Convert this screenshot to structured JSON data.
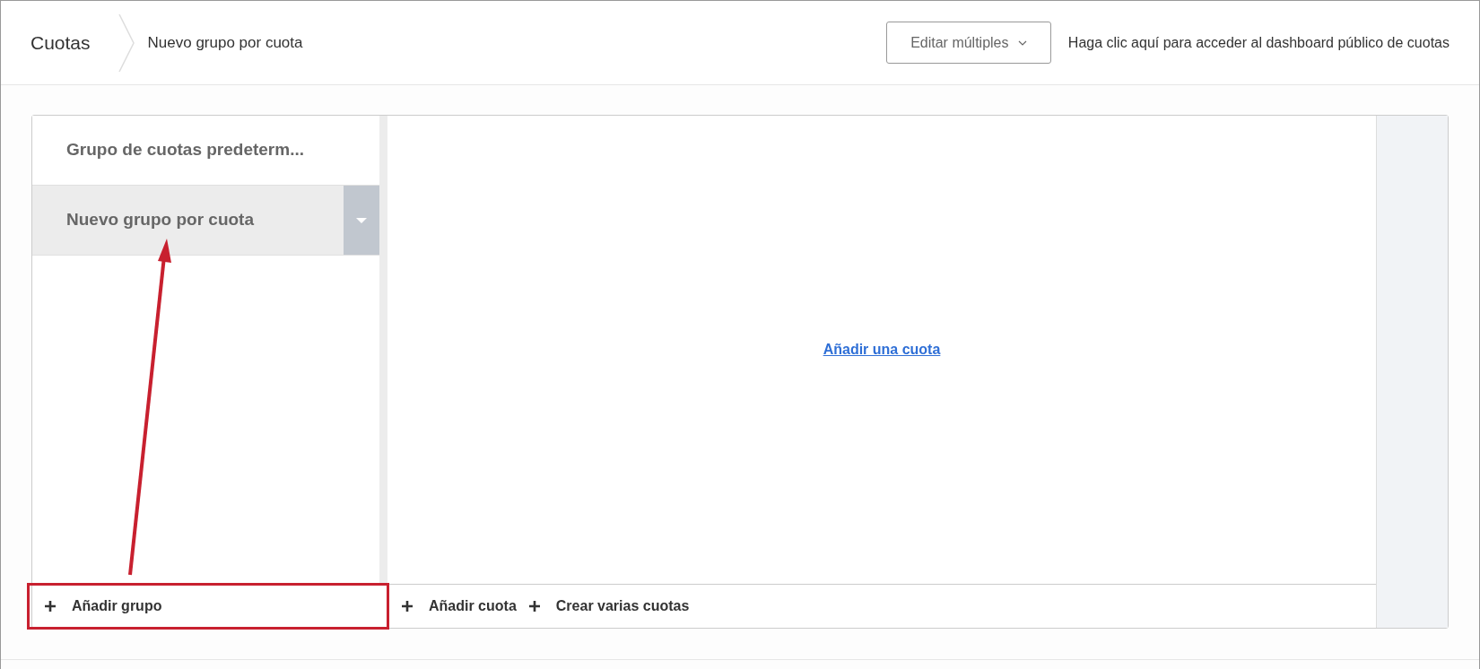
{
  "header": {
    "title": "Cuotas",
    "breadcrumb": "Nuevo grupo por cuota",
    "edit_button": "Editar múltiples",
    "dashboard_link": "Haga clic aquí para acceder al dashboard público de cuotas"
  },
  "groups": [
    {
      "label": "Grupo de cuotas predeterm...",
      "selected": false
    },
    {
      "label": "Nuevo grupo por cuota",
      "selected": true
    }
  ],
  "empty_link": "Añadir una cuota",
  "footer": {
    "add_group": "Añadir grupo",
    "add_quota": "Añadir cuota",
    "create_many": "Crear varias cuotas"
  }
}
